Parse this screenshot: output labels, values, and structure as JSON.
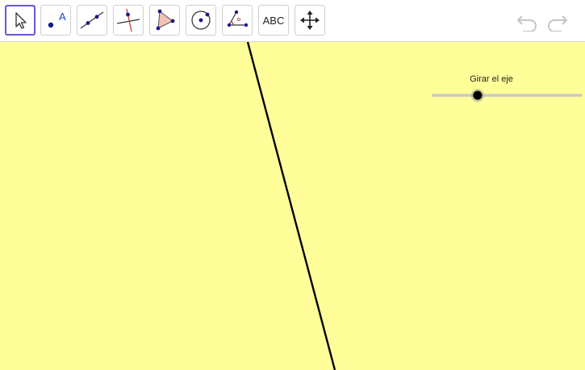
{
  "toolbar": {
    "tools": [
      {
        "name": "move",
        "icon": "move-arrow-icon",
        "selected": true
      },
      {
        "name": "point",
        "icon": "point-icon",
        "label": "A"
      },
      {
        "name": "line",
        "icon": "line-icon"
      },
      {
        "name": "perpendicular-line",
        "icon": "perpendicular-line-icon"
      },
      {
        "name": "polygon",
        "icon": "polygon-icon"
      },
      {
        "name": "circle",
        "icon": "circle-icon"
      },
      {
        "name": "angle",
        "icon": "angle-icon"
      },
      {
        "name": "text",
        "icon": "text-icon",
        "label": "ABC"
      },
      {
        "name": "move-graphics-view",
        "icon": "move-graphics-icon"
      }
    ],
    "undo": {
      "icon": "undo-icon"
    },
    "redo": {
      "icon": "redo-icon"
    }
  },
  "graphics": {
    "background_color": "#ffff99",
    "slider": {
      "label": "Girar el eje",
      "value_fraction": 0.3
    }
  },
  "colors": {
    "selected_border": "#6557d2",
    "point": "#1a1a8c",
    "polygon_fill": "#f2c1b5",
    "line": "#000000"
  }
}
